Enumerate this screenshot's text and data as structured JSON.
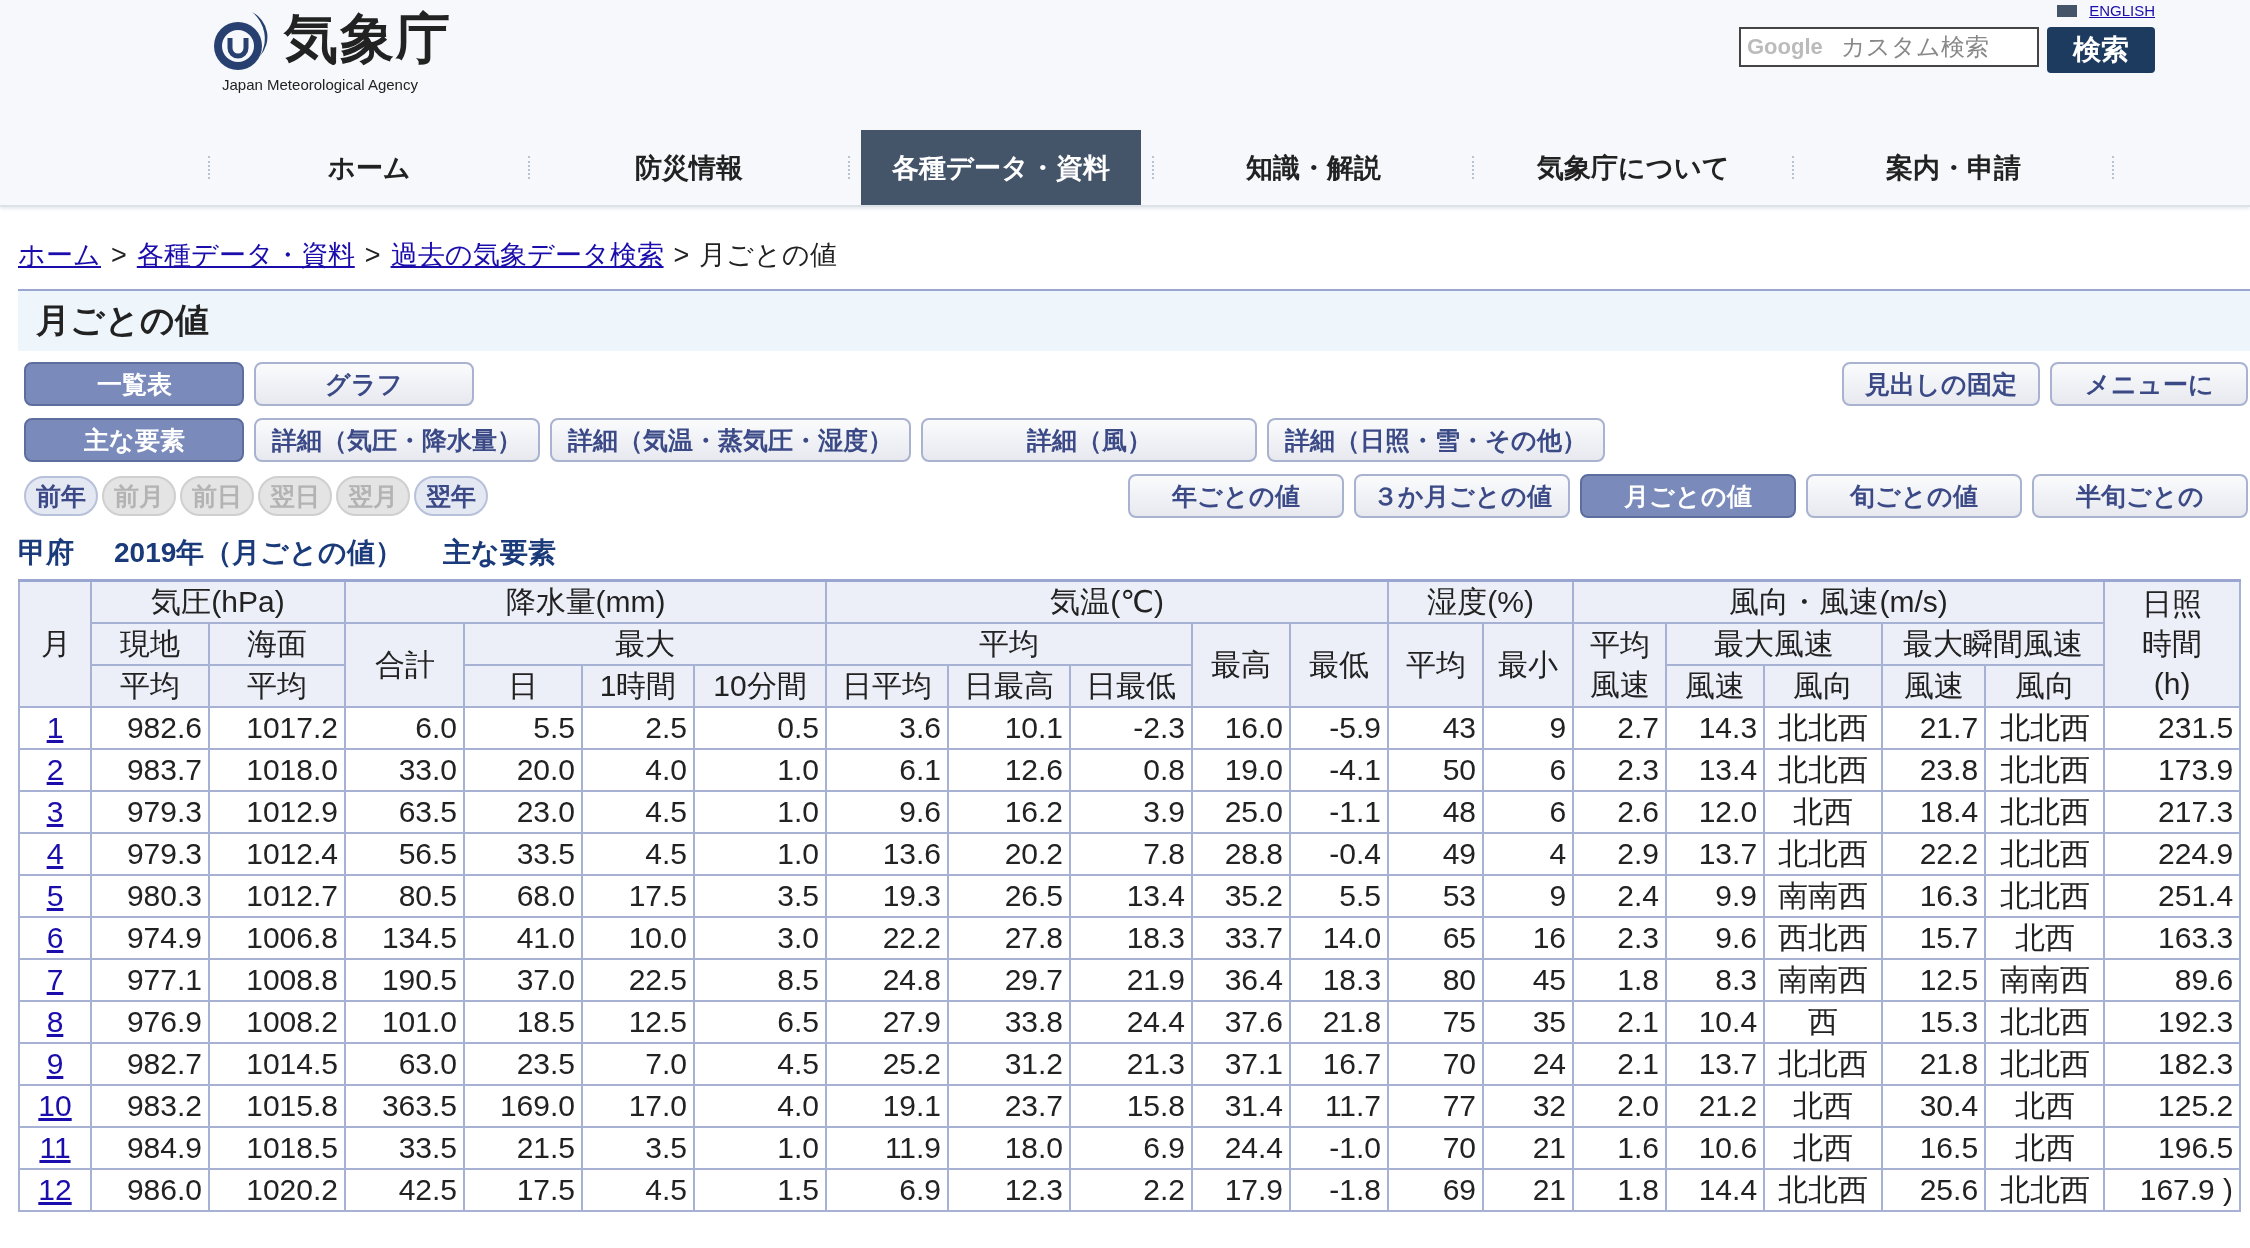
{
  "header": {
    "logo_text": "気象庁",
    "logo_subtext": "Japan Meteorological Agency",
    "english_link": "ENGLISH",
    "search": {
      "brand": "Google",
      "placeholder": "カスタム検索",
      "button": "検索"
    }
  },
  "nav": [
    {
      "label": "ホーム",
      "selected": false
    },
    {
      "label": "防災情報",
      "selected": false
    },
    {
      "label": "各種データ・資料",
      "selected": true
    },
    {
      "label": "知識・解説",
      "selected": false
    },
    {
      "label": "気象庁について",
      "selected": false
    },
    {
      "label": "案内・申請",
      "selected": false
    }
  ],
  "breadcrumb": [
    {
      "label": "ホーム",
      "kind": "link"
    },
    {
      "label": ">",
      "kind": "separator"
    },
    {
      "label": "各種データ・資料",
      "kind": "link"
    },
    {
      "label": ">",
      "kind": "separator"
    },
    {
      "label": "過去の気象データ検索",
      "kind": "link"
    },
    {
      "label": ">",
      "kind": "separator"
    },
    {
      "label": "月ごとの値",
      "kind": "current"
    }
  ],
  "page_title": "月ごとの値",
  "view_buttons": [
    {
      "label": "一覧表",
      "selected": true
    },
    {
      "label": "グラフ",
      "selected": false
    }
  ],
  "tool_buttons": [
    "見出しの固定",
    "メニューに"
  ],
  "element_buttons": [
    {
      "label": "主な要素",
      "selected": true
    },
    {
      "label": "詳細（気圧・降水量）",
      "selected": false
    },
    {
      "label": "詳細（気温・蒸気圧・湿度）",
      "selected": false
    },
    {
      "label": "詳細（風）",
      "selected": false
    },
    {
      "label": "詳細（日照・雪・その他）",
      "selected": false
    }
  ],
  "date_buttons": [
    {
      "label": "前年",
      "disabled": false
    },
    {
      "label": "前月",
      "disabled": true
    },
    {
      "label": "前日",
      "disabled": true
    },
    {
      "label": "翌日",
      "disabled": true
    },
    {
      "label": "翌月",
      "disabled": true
    },
    {
      "label": "翌年",
      "disabled": false
    }
  ],
  "period_buttons": [
    {
      "label": "年ごとの値",
      "selected": false
    },
    {
      "label": "３か月ごとの値",
      "selected": false
    },
    {
      "label": "月ごとの値",
      "selected": true
    },
    {
      "label": "旬ごとの値",
      "selected": false
    },
    {
      "label": "半旬ごとの",
      "selected": false
    }
  ],
  "caption": {
    "station": "甲府",
    "period": "2019年（月ごとの値）",
    "elements": "主な要素"
  },
  "table": {
    "header_rows": [
      [
        {
          "label": "月",
          "rowspan": 3
        },
        {
          "label": "気圧(hPa)",
          "colspan": 2
        },
        {
          "label": "降水量(mm)",
          "colspan": 4
        },
        {
          "label": "気温(℃)",
          "colspan": 5
        },
        {
          "label": "湿度(%)",
          "colspan": 2
        },
        {
          "label": "風向・風速(m/s)",
          "colspan": 5
        },
        {
          "label": "日照時間(h)",
          "rowspan": 3
        }
      ],
      [
        {
          "label": "現地"
        },
        {
          "label": "海面"
        },
        {
          "label": "合計",
          "rowspan": 2
        },
        {
          "label": "最大",
          "colspan": 3
        },
        {
          "label": "平均",
          "colspan": 3
        },
        {
          "label": "最高",
          "rowspan": 2
        },
        {
          "label": "最低",
          "rowspan": 2
        },
        {
          "label": "平均",
          "rowspan": 2
        },
        {
          "label": "最小",
          "rowspan": 2
        },
        {
          "label": "平均風速",
          "rowspan": 2
        },
        {
          "label": "最大風速",
          "colspan": 2
        },
        {
          "label": "最大瞬間風速",
          "colspan": 2
        }
      ],
      [
        {
          "label": "平均"
        },
        {
          "label": "平均"
        },
        {
          "label": "日"
        },
        {
          "label": "1時間"
        },
        {
          "label": "10分間"
        },
        {
          "label": "日平均"
        },
        {
          "label": "日最高"
        },
        {
          "label": "日最低"
        },
        {
          "label": "風速"
        },
        {
          "label": "風向"
        },
        {
          "label": "風速"
        },
        {
          "label": "風向"
        }
      ]
    ],
    "rows": [
      {
        "month": "1",
        "values": [
          "982.6",
          "1017.2",
          "6.0",
          "5.5",
          "2.5",
          "0.5",
          "3.6",
          "10.1",
          "-2.3",
          "16.0",
          "-5.9",
          "43",
          "9",
          "2.7",
          "14.3",
          "北北西",
          "21.7",
          "北北西",
          "231.5"
        ]
      },
      {
        "month": "2",
        "values": [
          "983.7",
          "1018.0",
          "33.0",
          "20.0",
          "4.0",
          "1.0",
          "6.1",
          "12.6",
          "0.8",
          "19.0",
          "-4.1",
          "50",
          "6",
          "2.3",
          "13.4",
          "北北西",
          "23.8",
          "北北西",
          "173.9"
        ]
      },
      {
        "month": "3",
        "values": [
          "979.3",
          "1012.9",
          "63.5",
          "23.0",
          "4.5",
          "1.0",
          "9.6",
          "16.2",
          "3.9",
          "25.0",
          "-1.1",
          "48",
          "6",
          "2.6",
          "12.0",
          "北西",
          "18.4",
          "北北西",
          "217.3"
        ]
      },
      {
        "month": "4",
        "values": [
          "979.3",
          "1012.4",
          "56.5",
          "33.5",
          "4.5",
          "1.0",
          "13.6",
          "20.2",
          "7.8",
          "28.8",
          "-0.4",
          "49",
          "4",
          "2.9",
          "13.7",
          "北北西",
          "22.2",
          "北北西",
          "224.9"
        ]
      },
      {
        "month": "5",
        "values": [
          "980.3",
          "1012.7",
          "80.5",
          "68.0",
          "17.5",
          "3.5",
          "19.3",
          "26.5",
          "13.4",
          "35.2",
          "5.5",
          "53",
          "9",
          "2.4",
          "9.9",
          "南南西",
          "16.3",
          "北北西",
          "251.4"
        ]
      },
      {
        "month": "6",
        "values": [
          "974.9",
          "1006.8",
          "134.5",
          "41.0",
          "10.0",
          "3.0",
          "22.2",
          "27.8",
          "18.3",
          "33.7",
          "14.0",
          "65",
          "16",
          "2.3",
          "9.6",
          "西北西",
          "15.7",
          "北西",
          "163.3"
        ]
      },
      {
        "month": "7",
        "values": [
          "977.1",
          "1008.8",
          "190.5",
          "37.0",
          "22.5",
          "8.5",
          "24.8",
          "29.7",
          "21.9",
          "36.4",
          "18.3",
          "80",
          "45",
          "1.8",
          "8.3",
          "南南西",
          "12.5",
          "南南西",
          "89.6"
        ]
      },
      {
        "month": "8",
        "values": [
          "976.9",
          "1008.2",
          "101.0",
          "18.5",
          "12.5",
          "6.5",
          "27.9",
          "33.8",
          "24.4",
          "37.6",
          "21.8",
          "75",
          "35",
          "2.1",
          "10.4",
          "西",
          "15.3",
          "北北西",
          "192.3"
        ]
      },
      {
        "month": "9",
        "values": [
          "982.7",
          "1014.5",
          "63.0",
          "23.5",
          "7.0",
          "4.5",
          "25.2",
          "31.2",
          "21.3",
          "37.1",
          "16.7",
          "70",
          "24",
          "2.1",
          "13.7",
          "北北西",
          "21.8",
          "北北西",
          "182.3"
        ]
      },
      {
        "month": "10",
        "values": [
          "983.2",
          "1015.8",
          "363.5",
          "169.0",
          "17.0",
          "4.0",
          "19.1",
          "23.7",
          "15.8",
          "31.4",
          "11.7",
          "77",
          "32",
          "2.0",
          "21.2",
          "北西",
          "30.4",
          "北西",
          "125.2"
        ]
      },
      {
        "month": "11",
        "values": [
          "984.9",
          "1018.5",
          "33.5",
          "21.5",
          "3.5",
          "1.0",
          "11.9",
          "18.0",
          "6.9",
          "24.4",
          "-1.0",
          "70",
          "21",
          "1.6",
          "10.6",
          "北西",
          "16.5",
          "北西",
          "196.5"
        ]
      },
      {
        "month": "12",
        "values": [
          "986.0",
          "1020.2",
          "42.5",
          "17.5",
          "4.5",
          "1.5",
          "6.9",
          "12.3",
          "2.2",
          "17.9",
          "-1.8",
          "69",
          "21",
          "1.8",
          "14.4",
          "北北西",
          "25.6",
          "北北西",
          "167.9 )"
        ]
      }
    ]
  }
}
